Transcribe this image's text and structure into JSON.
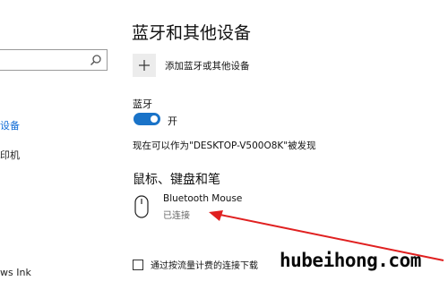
{
  "sidebar": {
    "search": {
      "value": "",
      "placeholder": ""
    },
    "items": [
      {
        "label": "设备",
        "active": true
      },
      {
        "label": "印机"
      },
      {
        "label": "ws Ink"
      }
    ]
  },
  "main": {
    "title": "蓝牙和其他设备",
    "add_device_label": "添加蓝牙或其他设备",
    "bluetooth": {
      "heading": "蓝牙",
      "toggle_state": "开",
      "on": true,
      "discoverable_text": "现在可以作为\"DESKTOP-V500O8K\"被发现"
    },
    "mouse_section": {
      "heading": "鼠标、键盘和笔",
      "device": {
        "name": "Bluetooth  Mouse",
        "status": "已连接",
        "icon": "mouse-icon"
      }
    },
    "metered": {
      "label": "通过按流量计费的连接下载",
      "checked": false
    }
  },
  "watermark": "hubeihong.com",
  "colors": {
    "accent": "#1a73c8",
    "arrow": "#e02020"
  }
}
